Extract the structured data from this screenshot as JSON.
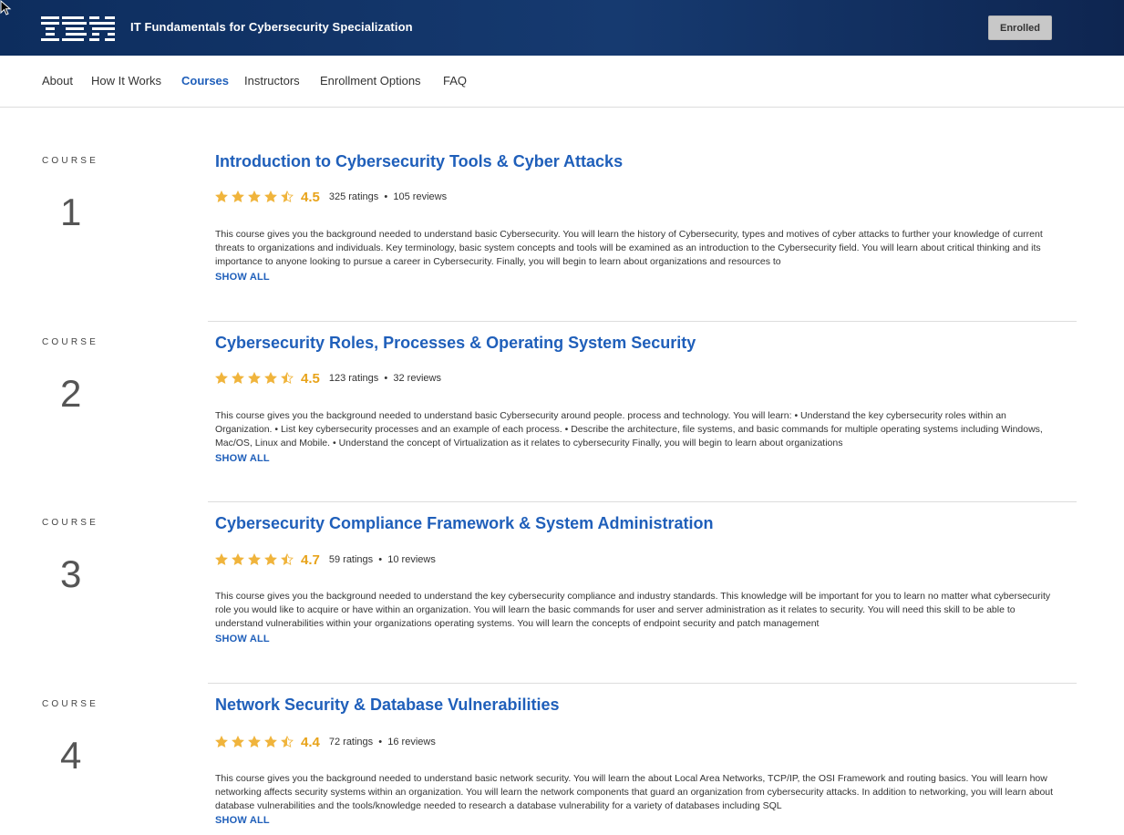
{
  "header": {
    "brand": "IBM",
    "title": "IT Fundamentals for Cybersecurity Specialization",
    "enrolled_label": "Enrolled"
  },
  "nav": {
    "items": [
      {
        "label": "About"
      },
      {
        "label": "How It Works"
      },
      {
        "label": "Courses"
      },
      {
        "label": "Instructors"
      },
      {
        "label": "Enrollment Options"
      },
      {
        "label": "FAQ"
      }
    ],
    "active": "Courses"
  },
  "courses": [
    {
      "label": "COURSE",
      "number": "1",
      "title": "Introduction to Cybersecurity Tools & Cyber Attacks",
      "rating": "4.5",
      "ratings_text": "325 ratings",
      "reviews_text": "105 reviews",
      "description": "This course gives you the background needed to understand basic Cybersecurity. You will learn the history of Cybersecurity, types and motives of cyber attacks to further your knowledge of current threats to organizations and individuals. Key terminology, basic system concepts and tools will be examined as an introduction to the Cybersecurity field. You will learn about critical thinking and its importance to anyone looking to pursue a career in Cybersecurity. Finally, you will begin to learn about organizations and resources to",
      "show_all": "SHOW ALL"
    },
    {
      "label": "COURSE",
      "number": "2",
      "title": "Cybersecurity Roles, Processes & Operating System Security",
      "rating": "4.5",
      "ratings_text": "123 ratings",
      "reviews_text": "32 reviews",
      "description": "This course gives you the background needed to understand basic Cybersecurity around people. process and technology. You will learn: • Understand the key cybersecurity roles within an Organization. • List key cybersecurity processes and an example of each process. • Describe the architecture, file systems, and basic commands for multiple operating systems including Windows, Mac/OS, Linux and Mobile. • Understand the concept of Virtualization as it relates to cybersecurity Finally, you will begin to learn about organizations",
      "show_all": "SHOW ALL"
    },
    {
      "label": "COURSE",
      "number": "3",
      "title": "Cybersecurity Compliance Framework & System Administration",
      "rating": "4.7",
      "ratings_text": "59 ratings",
      "reviews_text": "10 reviews",
      "description": "This course gives you the background needed to understand the key cybersecurity compliance and industry standards. This knowledge will be important for you to learn no matter what cybersecurity role you would like to acquire or have within an organization. You will learn the basic commands for user and server administration as it relates to security. You will need this skill to be able to understand vulnerabilities within your organizations operating systems. You will learn the concepts of endpoint security and patch management",
      "show_all": "SHOW ALL"
    },
    {
      "label": "COURSE",
      "number": "4",
      "title": "Network Security & Database Vulnerabilities",
      "rating": "4.4",
      "ratings_text": "72 ratings",
      "reviews_text": "16 reviews",
      "description": "This course gives you the background needed to understand basic network security. You will learn the about Local Area Networks, TCP/IP, the OSI Framework and routing basics. You will learn how networking affects security systems within an organization. You will learn the network components that guard an organization from cybersecurity attacks. In addition to networking, you will learn about database vulnerabilities and the tools/knowledge needed to research a database vulnerability for a variety of databases including SQL",
      "show_all": "SHOW ALL"
    }
  ],
  "stars_shown": 4.5,
  "colors": {
    "header_bg": "#163a70",
    "link_blue": "#1f5fba",
    "star_gold": "#f0b43c",
    "rating_gold": "#e8a31a"
  }
}
